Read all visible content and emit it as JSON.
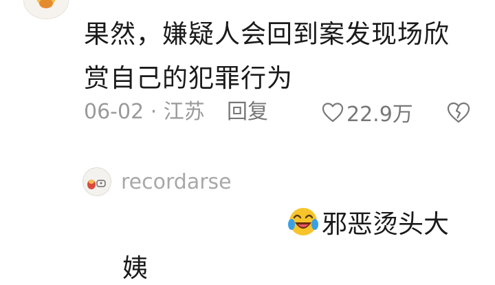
{
  "comment": {
    "text": "果然，嫌疑人会回到案发现场欣赏自己的犯罪行为",
    "meta": "06-02 · 江苏",
    "reply_label": "回复",
    "like_count": "22.9万"
  },
  "reply": {
    "username": "recordarse",
    "emoji_icon": "laughing-crying-emoji-icon",
    "line1": "邪恶烫头大",
    "line2": "姨"
  },
  "colors": {
    "text": "#1a1a1a",
    "meta": "#9a9a9a",
    "action": "#777777"
  }
}
